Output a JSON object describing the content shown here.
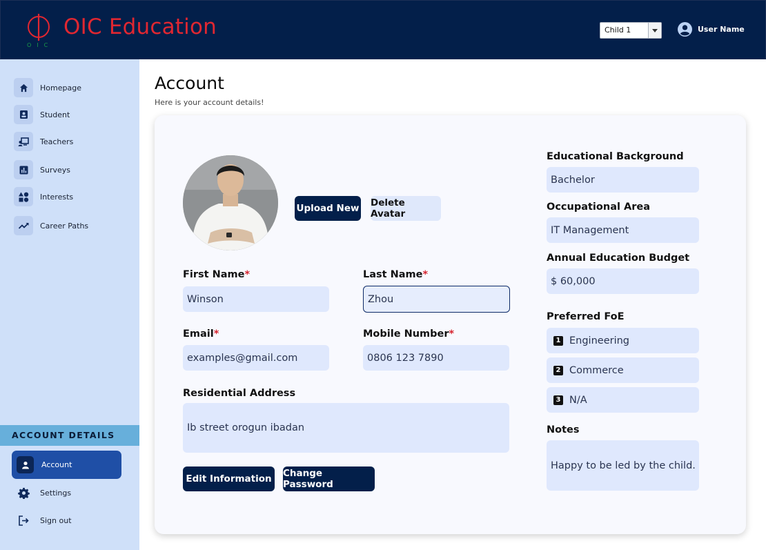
{
  "header": {
    "brand": "OIC Education",
    "logo_subtext": "OIC",
    "child_select": {
      "value": "Child 1"
    },
    "user_name": "User Name"
  },
  "sidebar": {
    "items": [
      {
        "label": "Homepage",
        "icon": "home-icon"
      },
      {
        "label": "Student",
        "icon": "student-badge-icon"
      },
      {
        "label": "Teachers",
        "icon": "teacher-icon"
      },
      {
        "label": "Surveys",
        "icon": "bar-chart-icon"
      },
      {
        "label": "Interests",
        "icon": "shapes-icon"
      },
      {
        "label": "Career Paths",
        "icon": "trend-icon"
      }
    ],
    "account_section_title": "ACCOUNT DETAILS",
    "account_items": [
      {
        "label": "Account",
        "icon": "person-icon"
      },
      {
        "label": "Settings",
        "icon": "gear-icon"
      },
      {
        "label": "Sign out",
        "icon": "sign-out-icon"
      }
    ]
  },
  "main": {
    "title": "Account",
    "subtitle": "Here is your account details!",
    "avatar_buttons": {
      "upload": "Upload New",
      "delete": "Delete Avatar"
    },
    "form": {
      "first_name": {
        "label": "First Name",
        "value": "Winson"
      },
      "last_name": {
        "label": "Last Name",
        "value": "Zhou"
      },
      "email": {
        "label": "Email",
        "value": "examples@gmail.com"
      },
      "mobile": {
        "label": "Mobile Number",
        "value": "0806 123 7890"
      },
      "address": {
        "label": "Residential Address",
        "value": "Ib street orogun ibadan"
      },
      "required_mark": "*"
    },
    "actions": {
      "edit": "Edit Information",
      "change_password": "Change Password"
    },
    "right": {
      "education": {
        "label": "Educational Background",
        "value": "Bachelor"
      },
      "occupation": {
        "label": "Occupational Area",
        "value": "IT Management"
      },
      "budget": {
        "label": "Annual Education Budget",
        "value": "$ 60,000"
      },
      "foe": {
        "label": "Preferred FoE",
        "items": [
          {
            "num": "1",
            "value": "Engineering"
          },
          {
            "num": "2",
            "value": "Commerce"
          },
          {
            "num": "3",
            "value": "N/A"
          }
        ]
      },
      "notes": {
        "label": "Notes",
        "value": "Happy to be led by the child."
      }
    }
  },
  "colors": {
    "navy": "#031f4a",
    "brand_red": "#e02731",
    "sidebar_bg": "#cfe0f9",
    "field_bg": "#dfe8fd",
    "active_nav": "#1f4fa6"
  }
}
